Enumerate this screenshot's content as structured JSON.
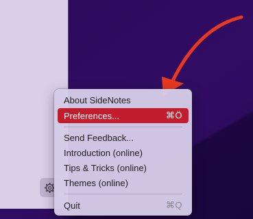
{
  "menu": {
    "about": "About SideNotes",
    "preferences": "Preferences...",
    "preferences_shortcut": "⌘Ö",
    "send_feedback": "Send Feedback...",
    "introduction": "Introduction (online)",
    "tips": "Tips & Tricks (online)",
    "themes": "Themes (online)",
    "quit": "Quit",
    "quit_shortcut": "⌘Q"
  },
  "colors": {
    "desktop": "#2b0a5c",
    "sidepanel": "#d9d0e8",
    "menu_background": "#d5cbe6",
    "selected_highlight": "#c21d2d",
    "arrow": "#e8391f"
  },
  "icons": {
    "gear_button": "gear-icon",
    "annotation": "arrow-icon"
  }
}
